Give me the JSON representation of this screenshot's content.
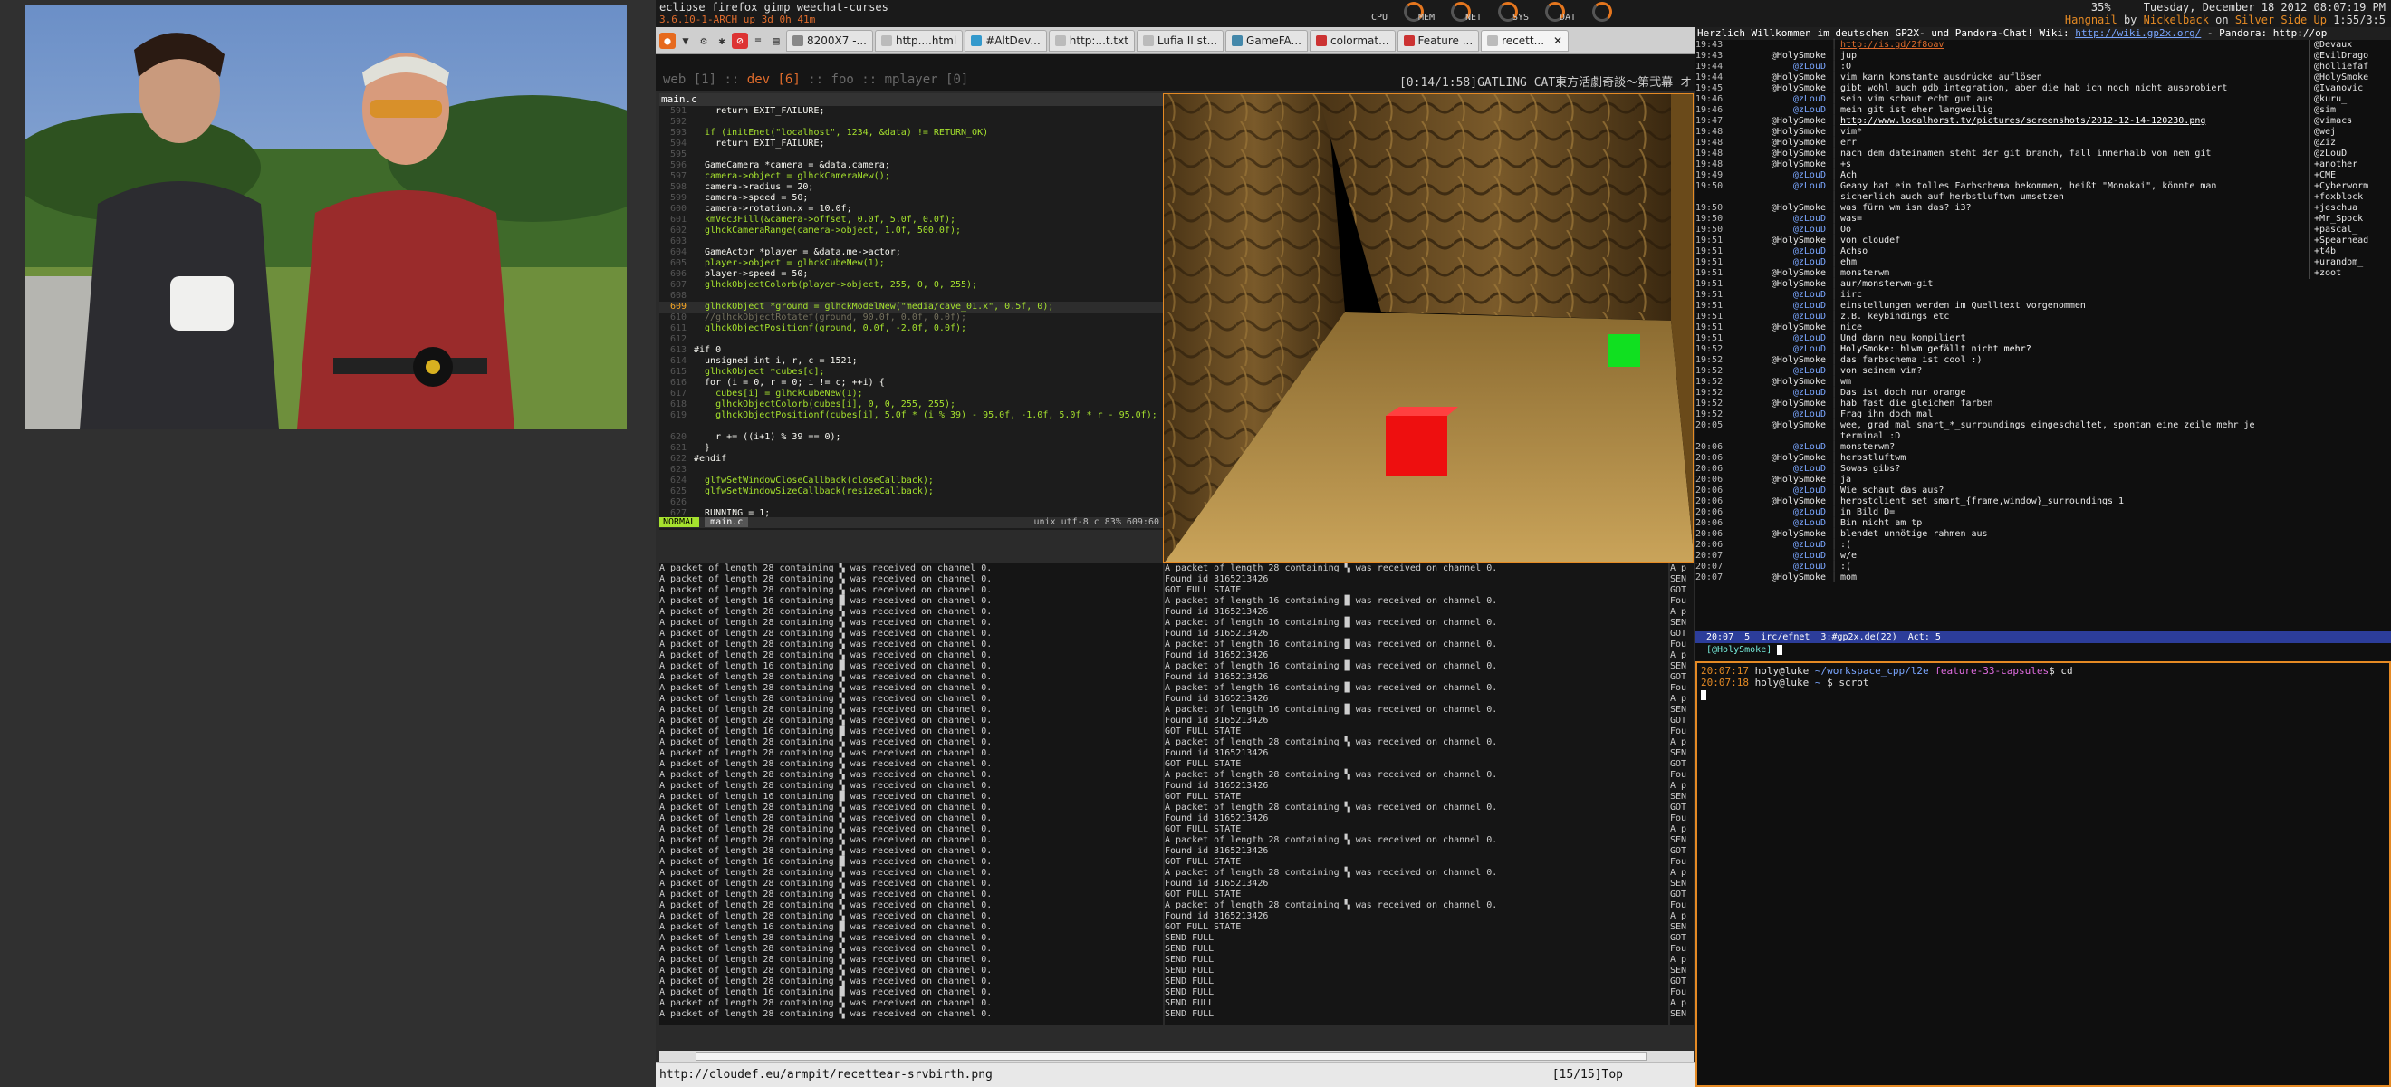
{
  "topbar": {
    "apps": "eclipse firefox gimp weechat-curses",
    "kernel": "3.6.10-1-ARCH  up 3d 0h 41m",
    "gauges": [
      "CPU",
      "MEM",
      "NET",
      "SYS",
      "DAT"
    ],
    "battery": "35%",
    "datetime": "Tuesday, December 18 2012 08:07:19 PM",
    "now_playing": {
      "title": "Hangnail",
      "by": "by",
      "artist": "Nickelback",
      "on": "on",
      "album": "Silver Side Up",
      "time": "1:55/3:5"
    }
  },
  "firefox": {
    "tabs": [
      "8200X7 -...",
      "http....html",
      "#AltDev...",
      "http:...t.txt",
      "Lufia II st...",
      "GameFA...",
      "colormat...",
      "Feature ...",
      "recett..."
    ],
    "status_url": "http://cloudef.eu/armpit/recettear-srvbirth.png",
    "status_pos": "[15/15]Top"
  },
  "tmux": {
    "windows": [
      "web",
      "[1]",
      "::",
      "dev",
      "[6]",
      "::",
      "foo",
      "::",
      "mplayer",
      "[0]"
    ],
    "now_playing": "[0:14/1:58]GATLING CAT東方活劇奇談～第弐幕 オ"
  },
  "vim": {
    "tab": "main.c",
    "lines": [
      {
        "n": "591",
        "t": "    return EXIT_FAILURE;"
      },
      {
        "n": "592",
        "t": ""
      },
      {
        "n": "593",
        "t": "  if (initEnet(\"localhost\", 1234, &data) != RETURN_OK)"
      },
      {
        "n": "594",
        "t": "    return EXIT_FAILURE;"
      },
      {
        "n": "595",
        "t": ""
      },
      {
        "n": "596",
        "t": "  GameCamera *camera = &data.camera;"
      },
      {
        "n": "597",
        "t": "  camera->object = glhckCameraNew();"
      },
      {
        "n": "598",
        "t": "  camera->radius = 20;"
      },
      {
        "n": "599",
        "t": "  camera->speed = 50;"
      },
      {
        "n": "600",
        "t": "  camera->rotation.x = 10.0f;"
      },
      {
        "n": "601",
        "t": "  kmVec3Fill(&camera->offset, 0.0f, 5.0f, 0.0f);"
      },
      {
        "n": "602",
        "t": "  glhckCameraRange(camera->object, 1.0f, 500.0f);"
      },
      {
        "n": "603",
        "t": ""
      },
      {
        "n": "604",
        "t": "  GameActor *player = &data.me->actor;"
      },
      {
        "n": "605",
        "t": "  player->object = glhckCubeNew(1);"
      },
      {
        "n": "606",
        "t": "  player->speed = 50;"
      },
      {
        "n": "607",
        "t": "  glhckObjectColorb(player->object, 255, 0, 0, 255);"
      },
      {
        "n": "608",
        "t": ""
      },
      {
        "n": "609",
        "t": "  glhckObject *ground = glhckModelNew(\"media/cave_01.x\", 0.5f, 0);"
      },
      {
        "n": "610",
        "t": "  //glhckObjectRotatef(ground, 90.0f, 0.0f, 0.0f);"
      },
      {
        "n": "611",
        "t": "  glhckObjectPositionf(ground, 0.0f, -2.0f, 0.0f);"
      },
      {
        "n": "612",
        "t": ""
      },
      {
        "n": "613",
        "t": "#if 0"
      },
      {
        "n": "614",
        "t": "  unsigned int i, r, c = 1521;"
      },
      {
        "n": "615",
        "t": "  glhckObject *cubes[c];"
      },
      {
        "n": "616",
        "t": "  for (i = 0, r = 0; i != c; ++i) {"
      },
      {
        "n": "617",
        "t": "    cubes[i] = glhckCubeNew(1);"
      },
      {
        "n": "618",
        "t": "    glhckObjectColorb(cubes[i], 0, 0, 255, 255);"
      },
      {
        "n": "619",
        "t": "    glhckObjectPositionf(cubes[i], 5.0f * (i % 39) - 95.0f, -1.0f, 5.0f * r - 95.0f);"
      },
      {
        "n": "   ",
        "t": ""
      },
      {
        "n": "620",
        "t": "    r += ((i+1) % 39 == 0);"
      },
      {
        "n": "621",
        "t": "  }"
      },
      {
        "n": "622",
        "t": "#endif"
      },
      {
        "n": "623",
        "t": ""
      },
      {
        "n": "624",
        "t": "  glfwSetWindowCloseCallback(closeCallback);"
      },
      {
        "n": "625",
        "t": "  glfwSetWindowSizeCallback(resizeCallback);"
      },
      {
        "n": "626",
        "t": ""
      },
      {
        "n": "627",
        "t": "  RUNNING = 1;"
      }
    ],
    "status": {
      "mode": "NORMAL",
      "file": "main.c",
      "info": "unix  utf-8  c  83%  609:60"
    }
  },
  "logs": {
    "left": [
      "A packet of length 16 containing █ was received on channel 0.",
      "A packet of length 28 containing ▚ was received on channel 0."
    ],
    "right": [
      "A packet of length 28 containing ▚ was received on channel 0.",
      "Found id 3165213426",
      "GOT FULL STATE",
      "A packet of length 16 containing █ was received on channel 0.",
      "SEND FULL"
    ],
    "right_pattern": [
      0,
      1,
      2,
      3,
      1,
      3,
      1,
      3,
      1,
      3,
      1,
      3,
      1,
      3,
      1,
      2,
      0,
      1,
      2,
      0,
      1,
      2,
      0,
      1,
      2,
      0,
      1,
      2,
      0,
      1,
      2,
      0,
      1,
      2,
      4,
      4,
      4,
      4,
      4,
      4,
      4,
      4
    ],
    "edge": [
      "A p",
      "SEN",
      "GOT",
      "Fou"
    ]
  },
  "irc": {
    "topic": "Herzlich Willkommen im deutschen GP2X- und Pandora-Chat! Wiki:",
    "topic_url": "http://wiki.gp2x.org/",
    "topic_end": " - Pandora: http://op",
    "lines": [
      {
        "t": "19:43",
        "n": "",
        "m": "http://is.gd/2f8oav",
        "link": true
      },
      {
        "t": "19:43",
        "n": "@HolySmoke",
        "m": "jup"
      },
      {
        "t": "19:44",
        "n": "@zLouD",
        "m": ":O"
      },
      {
        "t": "19:44",
        "n": "@HolySmoke",
        "m": "vim kann konstante ausdrücke auflösen"
      },
      {
        "t": "19:45",
        "n": "@HolySmoke",
        "m": "gibt wohl auch gdb integration, aber die hab ich noch nicht ausprobiert"
      },
      {
        "t": "19:46",
        "n": "@zLouD",
        "m": "sein vim schaut echt gut aus"
      },
      {
        "t": "19:46",
        "n": "@zLouD",
        "m": "mein git ist eher langweilig"
      },
      {
        "t": "19:47",
        "n": "@HolySmoke",
        "m": "http://www.localhorst.tv/pictures/screenshots/2012-12-14-120230.png",
        "link": true
      },
      {
        "t": "19:48",
        "n": "@HolySmoke",
        "m": "vim*"
      },
      {
        "t": "19:48",
        "n": "@HolySmoke",
        "m": "err"
      },
      {
        "t": "19:48",
        "n": "@HolySmoke",
        "m": "nach dem dateinamen steht der git branch, fall innerhalb von nem git"
      },
      {
        "t": "19:48",
        "n": "@HolySmoke",
        "m": "+s"
      },
      {
        "t": "19:49",
        "n": "@zLouD",
        "m": "Ach"
      },
      {
        "t": "19:50",
        "n": "@zLouD",
        "m": "Geany hat ein tolles Farbschema bekommen, heißt \"Monokai\", könnte man"
      },
      {
        "t": "",
        "n": "",
        "m": "sicherlich auch auf herbstluftwm umsetzen"
      },
      {
        "t": "19:50",
        "n": "@HolySmoke",
        "m": "was fürn wm isn das? i3?"
      },
      {
        "t": "19:50",
        "n": "@zLouD",
        "m": "was="
      },
      {
        "t": "19:50",
        "n": "@zLouD",
        "m": "Oo"
      },
      {
        "t": "19:51",
        "n": "@HolySmoke",
        "m": "von cloudef"
      },
      {
        "t": "19:51",
        "n": "@zLouD",
        "m": "Achso"
      },
      {
        "t": "19:51",
        "n": "@zLouD",
        "m": "ehm"
      },
      {
        "t": "19:51",
        "n": "@HolySmoke",
        "m": "monsterwm"
      },
      {
        "t": "19:51",
        "n": "@HolySmoke",
        "m": "aur/monsterwm-git"
      },
      {
        "t": "19:51",
        "n": "@zLouD",
        "m": "iirc"
      },
      {
        "t": "19:51",
        "n": "@zLouD",
        "m": "einstellungen werden im Quelltext vorgenommen"
      },
      {
        "t": "19:51",
        "n": "@zLouD",
        "m": "z.B. keybindings etc"
      },
      {
        "t": "19:51",
        "n": "@HolySmoke",
        "m": "nice"
      },
      {
        "t": "19:51",
        "n": "@zLouD",
        "m": "Und dann neu kompiliert"
      },
      {
        "t": "19:52",
        "n": "@zLouD",
        "m": "HolySmoke: hlwm gefällt nicht mehr?",
        "hl": true
      },
      {
        "t": "19:52",
        "n": "@HolySmoke",
        "m": "das farbschema ist cool :)"
      },
      {
        "t": "19:52",
        "n": "@zLouD",
        "m": "von seinem vim?"
      },
      {
        "t": "19:52",
        "n": "@HolySmoke",
        "m": "wm"
      },
      {
        "t": "19:52",
        "n": "@zLouD",
        "m": "Das ist doch nur orange"
      },
      {
        "t": "19:52",
        "n": "@HolySmoke",
        "m": "hab fast die gleichen farben"
      },
      {
        "t": "19:52",
        "n": "@zLouD",
        "m": "Frag ihn doch mal"
      },
      {
        "t": "20:05",
        "n": "@HolySmoke",
        "m": "wee, grad mal smart_*_surroundings eingeschaltet, spontan eine zeile mehr je"
      },
      {
        "t": "",
        "n": "",
        "m": "terminal :D"
      },
      {
        "t": "20:06",
        "n": "@zLouD",
        "m": "monsterwm?"
      },
      {
        "t": "20:06",
        "n": "@HolySmoke",
        "m": "herbstluftwm"
      },
      {
        "t": "20:06",
        "n": "@zLouD",
        "m": "Sowas gibs?"
      },
      {
        "t": "20:06",
        "n": "@HolySmoke",
        "m": "ja"
      },
      {
        "t": "20:06",
        "n": "@zLouD",
        "m": "Wie schaut das aus?"
      },
      {
        "t": "20:06",
        "n": "@HolySmoke",
        "m": "herbstclient set smart_{frame,window}_surroundings 1"
      },
      {
        "t": "20:06",
        "n": "@zLouD",
        "m": "in Bild D="
      },
      {
        "t": "20:06",
        "n": "@zLouD",
        "m": "Bin nicht am tp"
      },
      {
        "t": "20:06",
        "n": "@HolySmoke",
        "m": "blendet unnötige rahmen aus"
      },
      {
        "t": "20:06",
        "n": "@zLouD",
        "m": ":("
      },
      {
        "t": "20:07",
        "n": "@zLouD",
        "m": "w/e"
      },
      {
        "t": "20:07",
        "n": "@zLouD",
        "m": ":("
      },
      {
        "t": "20:07",
        "n": "@HolySmoke",
        "m": "mom"
      }
    ],
    "nicks": [
      "@Devaux",
      "@EvilDrago",
      "@holliefaf",
      "@HolySmoke",
      "@Ivanovic",
      "@kuru_",
      "@sim",
      "@vimacs",
      "@wej",
      "@Ziz",
      "@zLouD",
      "+another",
      "+CME",
      "+Cyberworm",
      "+foxblock",
      "+jeschua",
      "+Mr_Spock",
      "+pascal_",
      "+Spearhead",
      "+t4b",
      "+urandom_",
      "+zoot"
    ],
    "status": "20:07  5  irc/efnet  3:#gp2x.de(22)  Act: 5",
    "input": "[@HolySmoke]"
  },
  "terminal": [
    {
      "time": "20:07:17",
      "user": "holy@luke",
      "path": "~/workspace_cpp/l2e",
      "branch": "feature-33-capsules",
      "cmd": "$ cd"
    },
    {
      "time": "20:07:18",
      "user": "holy@luke",
      "path": "~",
      "branch": "",
      "cmd": "$ scrot"
    }
  ],
  "colors": {
    "accent": "#e58a24",
    "vim_green": "#a6e22e",
    "irc_status": "#2c3d9a"
  }
}
